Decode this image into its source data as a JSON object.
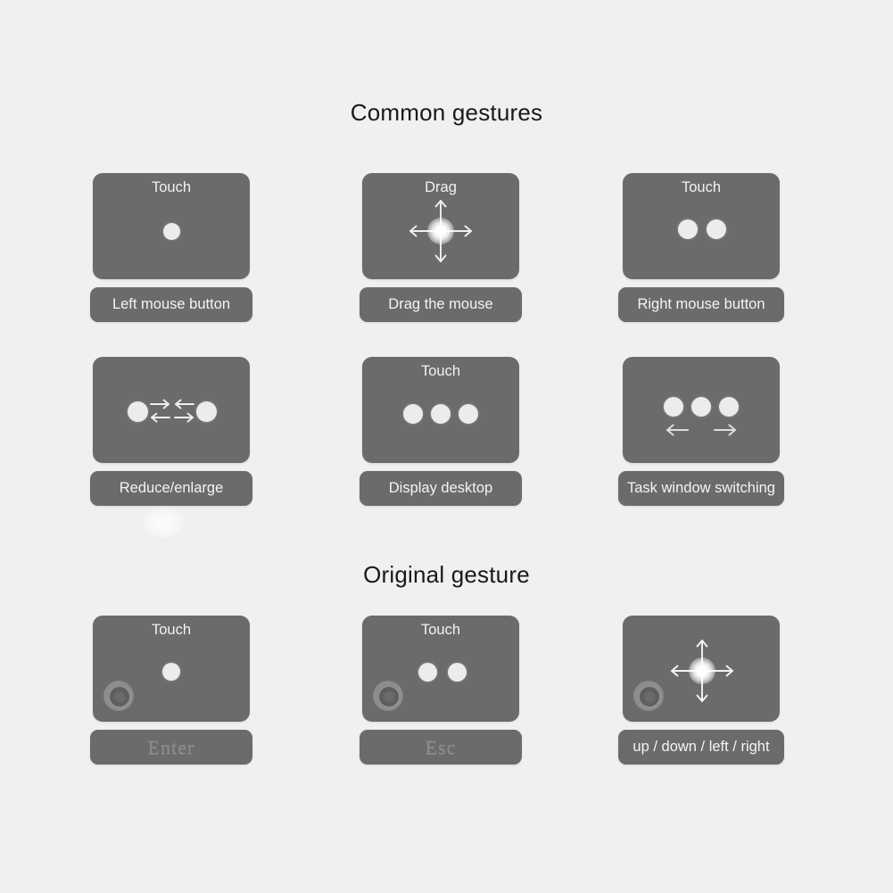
{
  "page": {
    "background_color": "#f0f0f0",
    "card_color": "#6b6b6b",
    "dot_color": "#ececec",
    "text_color": "#f2f2f2",
    "heading_color": "#191919"
  },
  "sections": [
    {
      "id": "common",
      "title": "Common gestures",
      "cards": [
        {
          "hint": "Touch",
          "caption": "Left mouse button",
          "icon": "one-finger-tap-icon",
          "fingers": 1,
          "arrows": []
        },
        {
          "hint": "Drag",
          "caption": "Drag the mouse",
          "icon": "four-way-drag-icon",
          "fingers": 1,
          "arrows": [
            "up",
            "down",
            "left",
            "right"
          ]
        },
        {
          "hint": "Touch",
          "caption": "Right mouse button",
          "icon": "two-finger-tap-icon",
          "fingers": 2,
          "arrows": []
        },
        {
          "hint": "",
          "caption": "Reduce/enlarge",
          "icon": "pinch-zoom-icon",
          "fingers": 2,
          "arrows": [
            "inward",
            "outward"
          ]
        },
        {
          "hint": "Touch",
          "caption": "Display desktop",
          "icon": "three-finger-tap-icon",
          "fingers": 3,
          "arrows": []
        },
        {
          "hint": "",
          "caption": "Task window switching",
          "icon": "three-finger-swipe-icon",
          "fingers": 3,
          "arrows": [
            "left",
            "right"
          ]
        }
      ]
    },
    {
      "id": "original",
      "title": "Original gesture",
      "cards": [
        {
          "hint": "Touch",
          "caption": "Enter",
          "caption_style": "key",
          "icon": "one-finger-tap-icon",
          "fingers": 1,
          "arrows": [],
          "corner_marker": "home-ring-icon"
        },
        {
          "hint": "Touch",
          "caption": "Esc",
          "caption_style": "key",
          "icon": "two-finger-tap-icon",
          "fingers": 2,
          "arrows": [],
          "corner_marker": "home-ring-icon"
        },
        {
          "hint": "",
          "caption": "up / down / left / right",
          "icon": "four-way-drag-icon",
          "fingers": 1,
          "arrows": [
            "up",
            "down",
            "left",
            "right"
          ],
          "corner_marker": "home-ring-icon"
        }
      ]
    }
  ]
}
